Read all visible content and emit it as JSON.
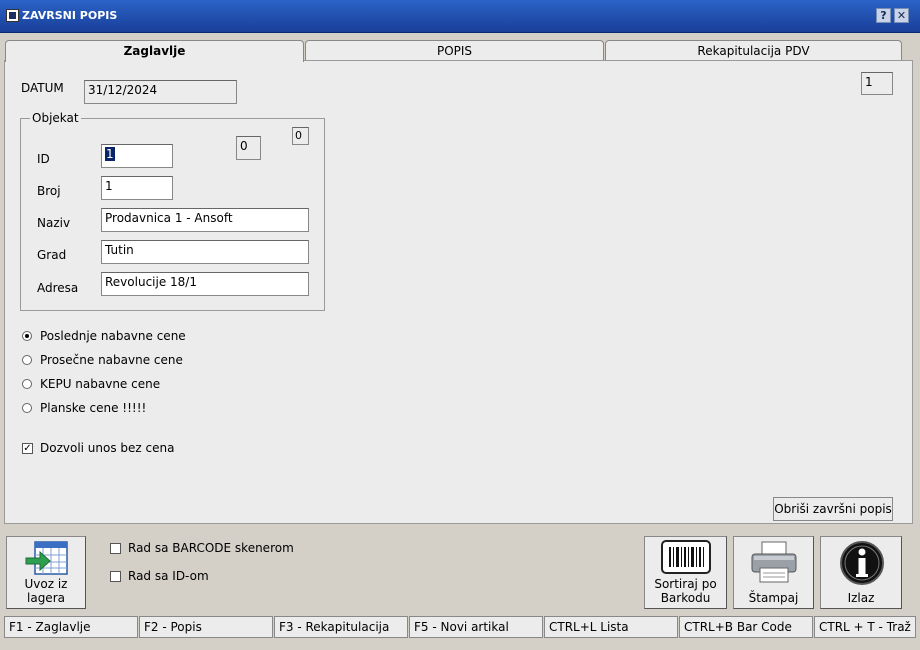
{
  "window": {
    "title": "ZAVRSNI POPIS",
    "help_label": "?",
    "close_label": "✕"
  },
  "tabs": [
    {
      "label": "Zaglavlje",
      "active": true
    },
    {
      "label": "POPIS",
      "active": false
    },
    {
      "label": "Rekapitulacija PDV",
      "active": false
    }
  ],
  "header": {
    "date_label": "DATUM",
    "date_value": "31/12/2024",
    "counter_value": "1"
  },
  "objekat": {
    "group_title": "Objekat",
    "id_label": "ID",
    "id_value": "1",
    "aux_value_1": "0",
    "aux_value_2": "0",
    "broj_label": "Broj",
    "broj_value": "1",
    "naziv_label": "Naziv",
    "naziv_value": "Prodavnica 1 - Ansoft",
    "grad_label": "Grad",
    "grad_value": "Tutin",
    "adresa_label": "Adresa",
    "adresa_value": "Revolucije 18/1"
  },
  "price_options": [
    {
      "label": "Poslednje nabavne cene",
      "selected": true
    },
    {
      "label": "Prosečne nabavne cene",
      "selected": false
    },
    {
      "label": "KEPU nabavne cene",
      "selected": false
    },
    {
      "label": "Planske cene !!!!!",
      "selected": false
    }
  ],
  "allow_entry": {
    "label": "Dozvoli unos bez cena",
    "checked": true
  },
  "delete_button_label": "Obriši završni popis",
  "bottom": {
    "import_label_1": "Uvoz iz",
    "import_label_2": "lagera",
    "barcode_scanner_label": "Rad sa BARCODE skenerom",
    "id_mode_label": "Rad sa ID-om",
    "sort_label_1": "Sortiraj po",
    "sort_label_2": "Barkodu",
    "print_label": "Štampaj",
    "exit_label": "Izlaz"
  },
  "statusbar": [
    "F1 - Zaglavlje",
    "F2 - Popis",
    "F3 - Rekapitulacija",
    "F5 - Novi artikal",
    "CTRL+L Lista",
    "CTRL+B Bar Code",
    "CTRL + T - Traž"
  ],
  "colors": {
    "titlebar": "#1f4fb0",
    "face": "#d4d0c8",
    "panel": "#ececec",
    "selection": "#0a246a"
  }
}
